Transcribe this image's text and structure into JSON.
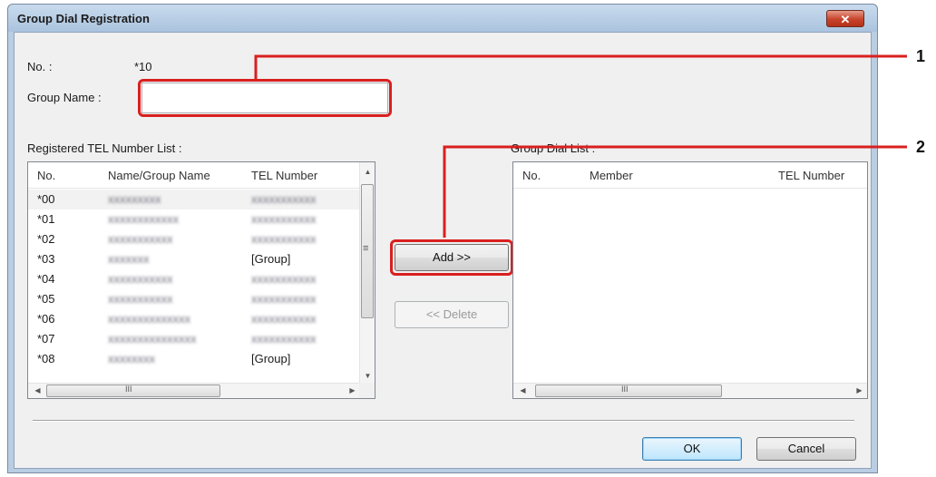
{
  "window": {
    "title": "Group Dial Registration",
    "close_glyph": "✕"
  },
  "form": {
    "no_label": "No. :",
    "no_value": "*10",
    "group_name_label": "Group Name :",
    "group_name_value": ""
  },
  "registered": {
    "label": "Registered TEL Number List :",
    "columns": [
      "No.",
      "Name/Group Name",
      "TEL Number"
    ],
    "rows": [
      {
        "no": "*00",
        "name": "xxxxxxxxx",
        "tel": "xxxxxxxxxxx",
        "tel_blurred": true
      },
      {
        "no": "*01",
        "name": "xxxxxxxxxxxx",
        "tel": "xxxxxxxxxxx",
        "tel_blurred": true
      },
      {
        "no": "*02",
        "name": "xxxxxxxxxxx",
        "tel": "xxxxxxxxxxx",
        "tel_blurred": true
      },
      {
        "no": "*03",
        "name": "xxxxxxx",
        "tel": "[Group]",
        "tel_blurred": false
      },
      {
        "no": "*04",
        "name": "xxxxxxxxxxx",
        "tel": "xxxxxxxxxxx",
        "tel_blurred": true
      },
      {
        "no": "*05",
        "name": "xxxxxxxxxxx",
        "tel": "xxxxxxxxxxx",
        "tel_blurred": true
      },
      {
        "no": "*06",
        "name": "xxxxxxxxxxxxxx",
        "tel": "xxxxxxxxxxx",
        "tel_blurred": true
      },
      {
        "no": "*07",
        "name": "xxxxxxxxxxxxxxx",
        "tel": "xxxxxxxxxxx",
        "tel_blurred": true
      },
      {
        "no": "*08",
        "name": "xxxxxxxx",
        "tel": "[Group]",
        "tel_blurred": false
      }
    ],
    "hscroll_grip": "III",
    "vscroll_grip": "≡"
  },
  "group_dial": {
    "label": "Group Dial List :",
    "columns": [
      "No.",
      "Member",
      "TEL Number"
    ],
    "rows": [],
    "hscroll_grip": "III"
  },
  "buttons": {
    "add": "Add >>",
    "delete": "<< Delete",
    "ok": "OK",
    "cancel": "Cancel"
  },
  "callouts": [
    "1",
    "2"
  ],
  "colors": {
    "highlight": "#d9201f"
  }
}
